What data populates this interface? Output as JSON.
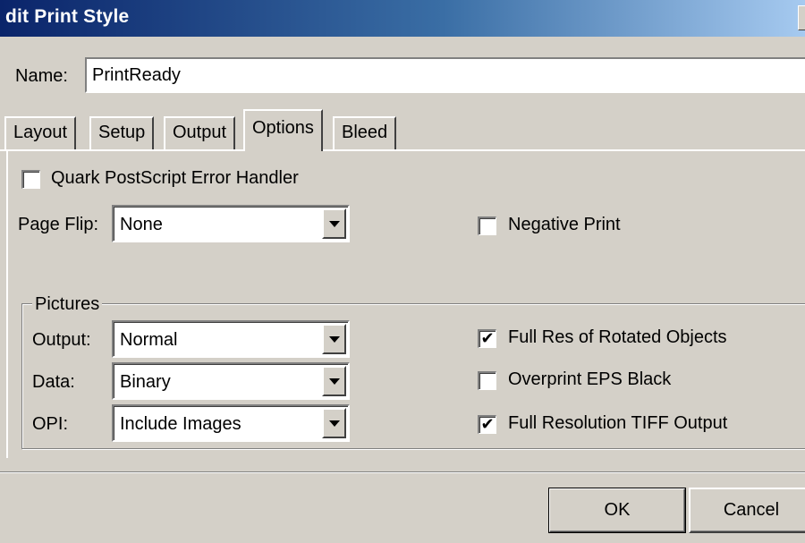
{
  "window": {
    "title": "dit Print Style"
  },
  "name": {
    "label": "Name:",
    "value": "PrintReady"
  },
  "tabs": [
    {
      "label": "Layout",
      "active": false
    },
    {
      "label": "Setup",
      "active": false
    },
    {
      "label": "Output",
      "active": false
    },
    {
      "label": "Options",
      "active": true
    },
    {
      "label": "Bleed",
      "active": false
    }
  ],
  "options": {
    "error_handler": {
      "label": "Quark PostScript Error Handler",
      "checked": false
    },
    "page_flip": {
      "label": "Page Flip:",
      "value": "None"
    },
    "negative_print": {
      "label": "Negative Print",
      "checked": false
    }
  },
  "pictures": {
    "legend": "Pictures",
    "output": {
      "label": "Output:",
      "value": "Normal"
    },
    "data": {
      "label": "Data:",
      "value": "Binary"
    },
    "opi": {
      "label": "OPI:",
      "value": "Include Images"
    },
    "full_res_rotated": {
      "label": "Full Res of Rotated Objects",
      "checked": true,
      "mark": "✔"
    },
    "overprint_eps": {
      "label": "Overprint EPS Black",
      "checked": false,
      "mark": ""
    },
    "full_res_tiff": {
      "label": "Full Resolution TIFF Output",
      "checked": true,
      "mark": "✔"
    }
  },
  "buttons": {
    "ok": "OK",
    "cancel": "Cancel"
  }
}
